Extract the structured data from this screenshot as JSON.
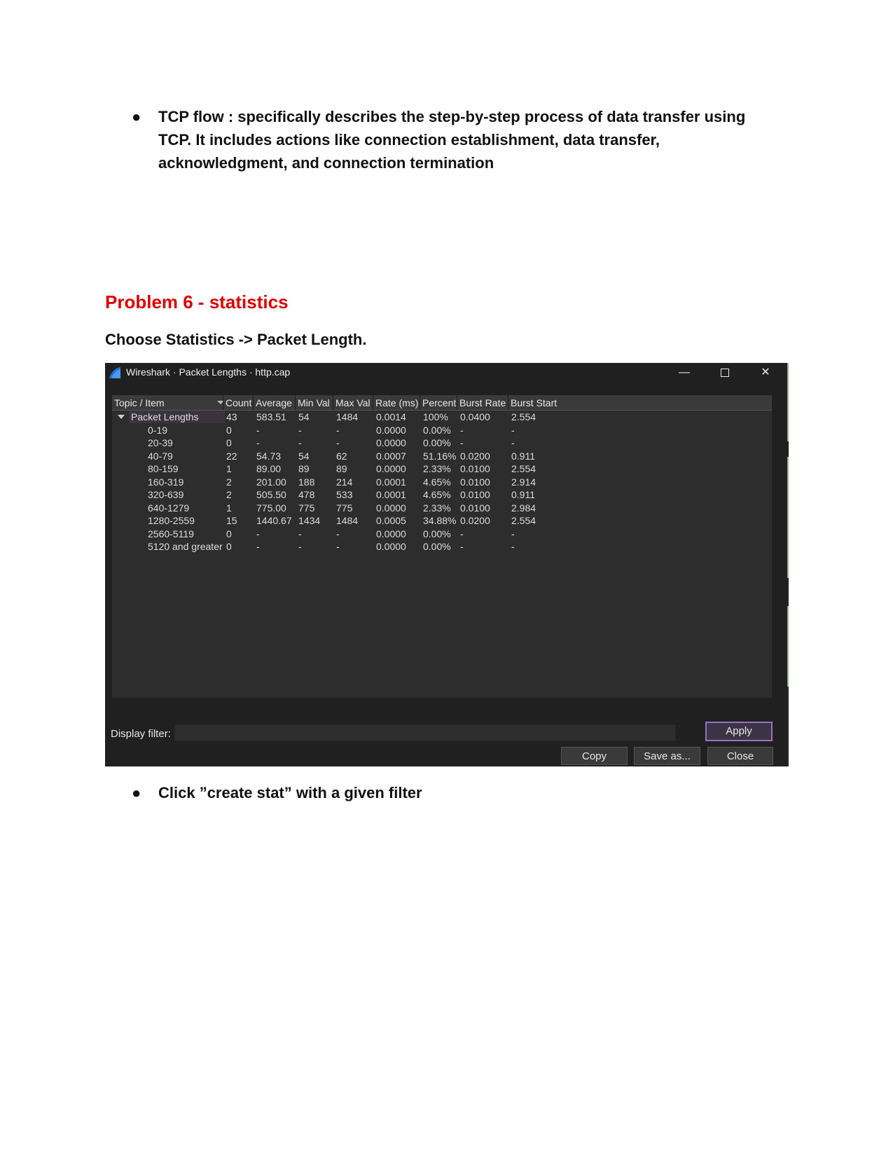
{
  "doc": {
    "bullet1": "TCP flow : specifically describes the step-by-step process of data transfer using TCP. It includes actions like connection establishment, data transfer, acknowledgment, and connection termination",
    "heading": "Problem 6 - statistics",
    "instruction": "Choose Statistics -> Packet Length.",
    "bullet2": "Click ”create stat” with a given filter"
  },
  "window": {
    "title": "Wireshark · Packet Lengths · http.cap",
    "minimize": "—",
    "close": "✕"
  },
  "table": {
    "headers": [
      "Topic / Item",
      "Count",
      "Average",
      "Min Val",
      "Max Val",
      "Rate (ms)",
      "Percent",
      "Burst Rate",
      "Burst Start"
    ],
    "rows": [
      [
        "Packet Lengths",
        "43",
        "583.51",
        "54",
        "1484",
        "0.0014",
        "100%",
        "0.0400",
        "2.554"
      ],
      [
        "0-19",
        "0",
        "-",
        "-",
        "-",
        "0.0000",
        "0.00%",
        "-",
        "-"
      ],
      [
        "20-39",
        "0",
        "-",
        "-",
        "-",
        "0.0000",
        "0.00%",
        "-",
        "-"
      ],
      [
        "40-79",
        "22",
        "54.73",
        "54",
        "62",
        "0.0007",
        "51.16%",
        "0.0200",
        "0.911"
      ],
      [
        "80-159",
        "1",
        "89.00",
        "89",
        "89",
        "0.0000",
        "2.33%",
        "0.0100",
        "2.554"
      ],
      [
        "160-319",
        "2",
        "201.00",
        "188",
        "214",
        "0.0001",
        "4.65%",
        "0.0100",
        "2.914"
      ],
      [
        "320-639",
        "2",
        "505.50",
        "478",
        "533",
        "0.0001",
        "4.65%",
        "0.0100",
        "0.911"
      ],
      [
        "640-1279",
        "1",
        "775.00",
        "775",
        "775",
        "0.0000",
        "2.33%",
        "0.0100",
        "2.984"
      ],
      [
        "1280-2559",
        "15",
        "1440.67",
        "1434",
        "1484",
        "0.0005",
        "34.88%",
        "0.0200",
        "2.554"
      ],
      [
        "2560-5119",
        "0",
        "-",
        "-",
        "-",
        "0.0000",
        "0.00%",
        "-",
        "-"
      ],
      [
        "5120 and greater",
        "0",
        "-",
        "-",
        "-",
        "0.0000",
        "0.00%",
        "-",
        "-"
      ]
    ]
  },
  "filter": {
    "label": "Display filter:",
    "value": ""
  },
  "buttons": {
    "apply": "Apply",
    "copy": "Copy",
    "save": "Save as...",
    "close": "Close"
  },
  "icons": {
    "bullet": "bullet-dot-icon",
    "app": "wireshark-fin-icon"
  }
}
